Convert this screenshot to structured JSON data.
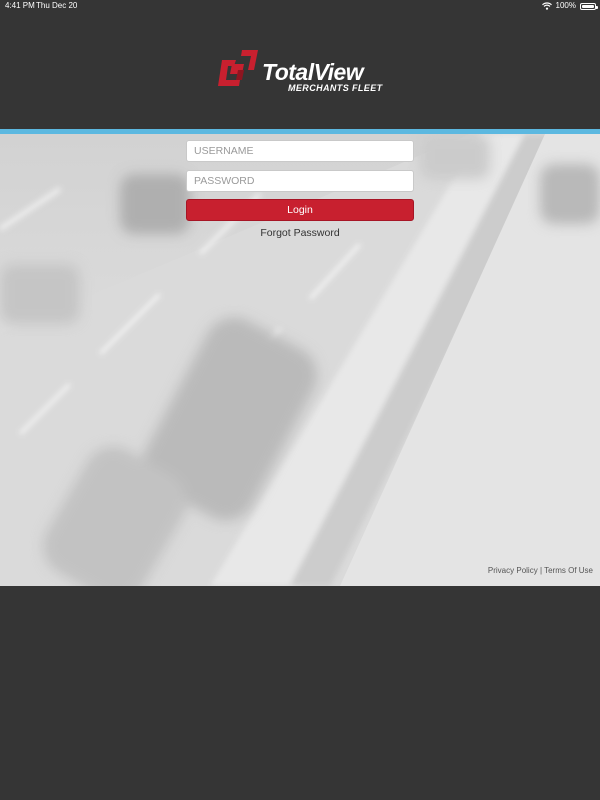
{
  "status_bar": {
    "time": "4:41 PM",
    "date": "Thu Dec 20",
    "battery": "100%",
    "battery_level": 1.0
  },
  "brand": {
    "name": "TotalView",
    "subtitle": "MERCHANTS FLEET",
    "accent_color": "#c8202f",
    "bar_color": "#5cb8e0"
  },
  "login": {
    "username_placeholder": "USERNAME",
    "password_placeholder": "PASSWORD",
    "login_label": "Login",
    "forgot_label": "Forgot Password"
  },
  "footer": {
    "privacy_label": "Privacy Policy",
    "separator": "|",
    "terms_label": "Terms Of Use"
  }
}
